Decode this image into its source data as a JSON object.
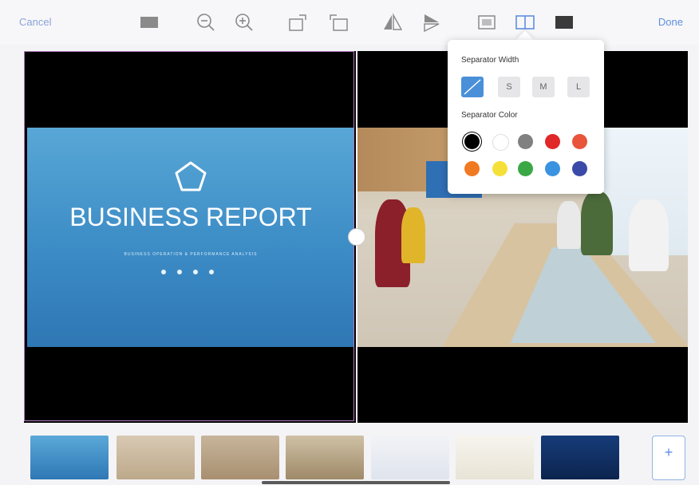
{
  "toolbar": {
    "cancel_label": "Cancel",
    "done_label": "Done",
    "icons": [
      "rectangle-icon",
      "zoom-out-icon",
      "zoom-in-icon",
      "rotate-right-icon",
      "rotate-left-icon",
      "flip-horizontal-icon",
      "flip-vertical-icon",
      "fit-icon",
      "split-icon",
      "fill-icon"
    ]
  },
  "slide": {
    "title": "BUSINESS REPORT",
    "subtitle": "BUSINESS OPERATION & PERFORMANCE ANALYSIS"
  },
  "popover": {
    "width_label": "Separator Width",
    "width_options": [
      "",
      "S",
      "M",
      "L"
    ],
    "selected_width_index": 0,
    "color_label": "Separator Color",
    "colors": [
      "#000000",
      "#ffffff",
      "#808080",
      "#e02828",
      "#e8553a",
      "#f07a22",
      "#f5e03a",
      "#3aa845",
      "#3a93e0",
      "#3b4aa8"
    ],
    "selected_color_index": 0
  },
  "thumbnails": {
    "add_label": "+"
  },
  "colors": {
    "accent": "#5f8ee0",
    "selection_border": "#b27ac2"
  }
}
